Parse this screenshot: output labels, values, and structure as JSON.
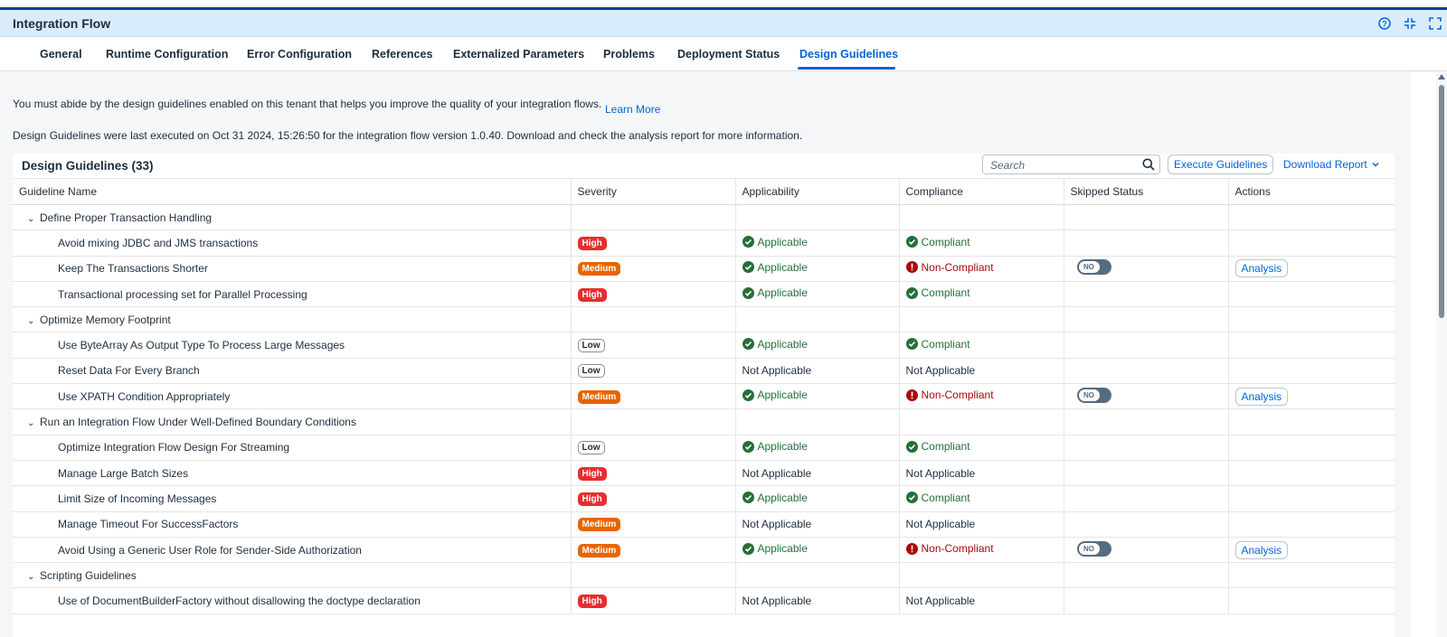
{
  "header": {
    "title": "Integration Flow",
    "icons": [
      "help-icon",
      "exit-fullscreen-icon",
      "fullscreen-icon"
    ]
  },
  "tabs": [
    {
      "label": "General"
    },
    {
      "label": "Runtime Configuration"
    },
    {
      "label": "Error Configuration"
    },
    {
      "label": "References"
    },
    {
      "label": "Externalized Parameters"
    },
    {
      "label": "Problems"
    },
    {
      "label": "Deployment Status"
    },
    {
      "label": "Design Guidelines",
      "active": true
    }
  ],
  "info": {
    "line1": "You must abide by the design guidelines enabled on this tenant that helps you improve the quality of your integration flows.",
    "learn_more": "Learn More",
    "line2": "Design Guidelines were last executed on Oct 31 2024, 15:26:50 for the integration flow version 1.0.40. Download and check the analysis report for more information."
  },
  "panel": {
    "title": "Design Guidelines (33)",
    "search_placeholder": "Search",
    "execute_label": "Execute Guidelines",
    "download_label": "Download Report"
  },
  "columns": [
    "Guideline Name",
    "Severity",
    "Applicability",
    "Compliance",
    "Skipped Status",
    "Actions"
  ],
  "rows": [
    {
      "type": "group",
      "name": "Define Proper Transaction Handling"
    },
    {
      "type": "item",
      "name": "Avoid mixing JDBC and JMS transactions",
      "severity": "High",
      "applicability": "Applicable",
      "compliance": "Compliant"
    },
    {
      "type": "item",
      "name": "Keep The Transactions Shorter",
      "severity": "Medium",
      "applicability": "Applicable",
      "compliance": "Non-Compliant",
      "skipped": "NO",
      "action": "Analysis"
    },
    {
      "type": "item",
      "name": "Transactional processing set for Parallel Processing",
      "severity": "High",
      "applicability": "Applicable",
      "compliance": "Compliant"
    },
    {
      "type": "group",
      "name": "Optimize Memory Footprint"
    },
    {
      "type": "item",
      "name": "Use ByteArray As Output Type To Process Large Messages",
      "severity": "Low",
      "applicability": "Applicable",
      "compliance": "Compliant"
    },
    {
      "type": "item",
      "name": "Reset Data For Every Branch",
      "severity": "Low",
      "applicability": "Not Applicable",
      "compliance": "Not Applicable"
    },
    {
      "type": "item",
      "name": "Use XPATH Condition Appropriately",
      "severity": "Medium",
      "applicability": "Applicable",
      "compliance": "Non-Compliant",
      "skipped": "NO",
      "action": "Analysis"
    },
    {
      "type": "group",
      "name": "Run an Integration Flow Under Well-Defined Boundary Conditions"
    },
    {
      "type": "item",
      "name": "Optimize Integration Flow Design For Streaming",
      "severity": "Low",
      "applicability": "Applicable",
      "compliance": "Compliant"
    },
    {
      "type": "item",
      "name": "Manage Large Batch Sizes",
      "severity": "High",
      "applicability": "Not Applicable",
      "compliance": "Not Applicable"
    },
    {
      "type": "item",
      "name": "Limit Size of Incoming Messages",
      "severity": "High",
      "applicability": "Applicable",
      "compliance": "Compliant"
    },
    {
      "type": "item",
      "name": "Manage Timeout For SuccessFactors",
      "severity": "Medium",
      "applicability": "Not Applicable",
      "compliance": "Not Applicable"
    },
    {
      "type": "item",
      "name": "Avoid Using a Generic User Role for Sender-Side Authorization",
      "severity": "Medium",
      "applicability": "Applicable",
      "compliance": "Non-Compliant",
      "skipped": "NO",
      "action": "Analysis"
    },
    {
      "type": "group",
      "name": "Scripting Guidelines"
    },
    {
      "type": "item",
      "name": "Use of DocumentBuilderFactory without disallowing the doctype declaration",
      "severity": "High",
      "applicability": "Not Applicable",
      "compliance": "Not Applicable"
    }
  ],
  "colors": {
    "accent": "#0064d9",
    "high": "#e62e2e",
    "medium": "#e76500",
    "positive": "#256f3a",
    "negative": "#aa0808"
  }
}
